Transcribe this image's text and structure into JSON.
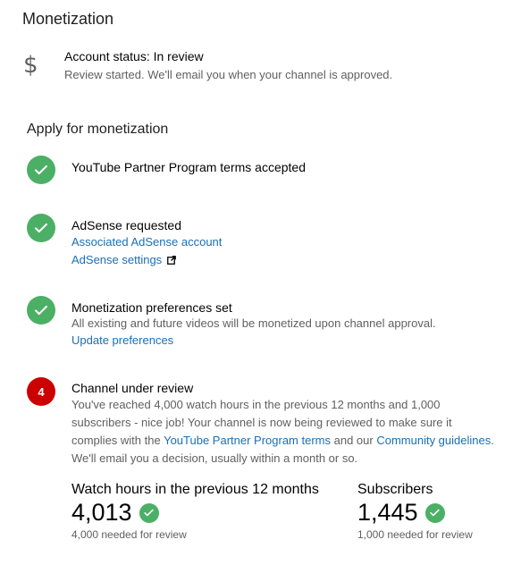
{
  "page": {
    "title": "Monetization"
  },
  "account_status": {
    "icon": "dollar-icon",
    "title": "Account status: In review",
    "description": "Review started. We'll email you when your channel is approved."
  },
  "apply": {
    "section_title": "Apply for monetization",
    "steps": [
      {
        "state": "done",
        "title": "YouTube Partner Program terms accepted"
      },
      {
        "state": "done",
        "title": "AdSense requested",
        "links": [
          "Associated AdSense account",
          "AdSense settings"
        ]
      },
      {
        "state": "done",
        "title": "Monetization preferences set",
        "description": "All existing and future videos will be monetized upon channel approval.",
        "links": [
          "Update preferences"
        ]
      },
      {
        "state": "in-review",
        "badge": "4",
        "title": "Channel under review",
        "description_line1": "You've reached 4,000 watch hours in the previous 12 months and 1,000",
        "description_line2": "subscribers - nice job! Your channel is now being reviewed to make sure it",
        "description_line3_prefix": "complies with the ",
        "link_terms": "YouTube Partner Program terms",
        "description_line3_mid": " and our ",
        "link_guidelines": "Community guidelines",
        "description_line3_suffix": ".",
        "description_line4": "We'll email you a decision, usually within a month or so."
      }
    ]
  },
  "metrics": [
    {
      "label": "Watch hours in the previous 12 months",
      "value": "4,013",
      "needed": "4,000 needed for review"
    },
    {
      "label": "Subscribers",
      "value": "1,445",
      "needed": "1,000 needed for review"
    }
  ],
  "colors": {
    "success": "#4caf66",
    "alert": "#cc0000",
    "link": "#1a6fb5",
    "secondary_text": "#606060"
  }
}
